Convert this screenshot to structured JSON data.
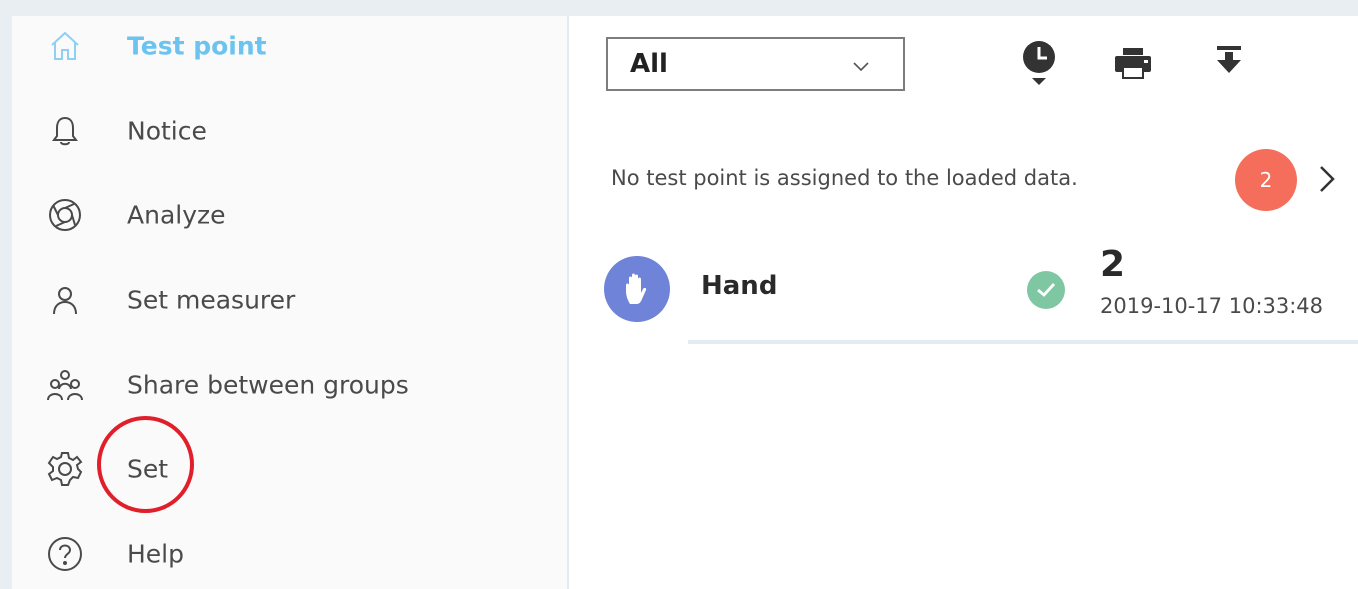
{
  "sidebar": {
    "items": [
      {
        "label": "Test point",
        "icon": "home-icon",
        "active": true
      },
      {
        "label": "Notice",
        "icon": "bell-icon"
      },
      {
        "label": "Analyze",
        "icon": "aperture-icon"
      },
      {
        "label": "Set measurer",
        "icon": "person-icon"
      },
      {
        "label": "Share between groups",
        "icon": "group-icon"
      },
      {
        "label": "Set",
        "icon": "gear-icon"
      },
      {
        "label": "Help",
        "icon": "help-icon"
      }
    ]
  },
  "toolbar": {
    "filter_value": "All",
    "icons": [
      "history-icon",
      "print-icon",
      "download-icon"
    ]
  },
  "notice": {
    "text": "No test point is assigned to the loaded data.",
    "badge_count": "2"
  },
  "list": [
    {
      "name": "Hand",
      "count": "2",
      "timestamp": "2019-10-17 10:33:48",
      "icon": "hand-icon",
      "status": "check-icon"
    }
  ],
  "colors": {
    "accent": "#6cc3ef",
    "badge": "#f46e5b",
    "avatar": "#6f83d8",
    "check": "#7ec7a2",
    "highlight": "#e01f2a"
  }
}
